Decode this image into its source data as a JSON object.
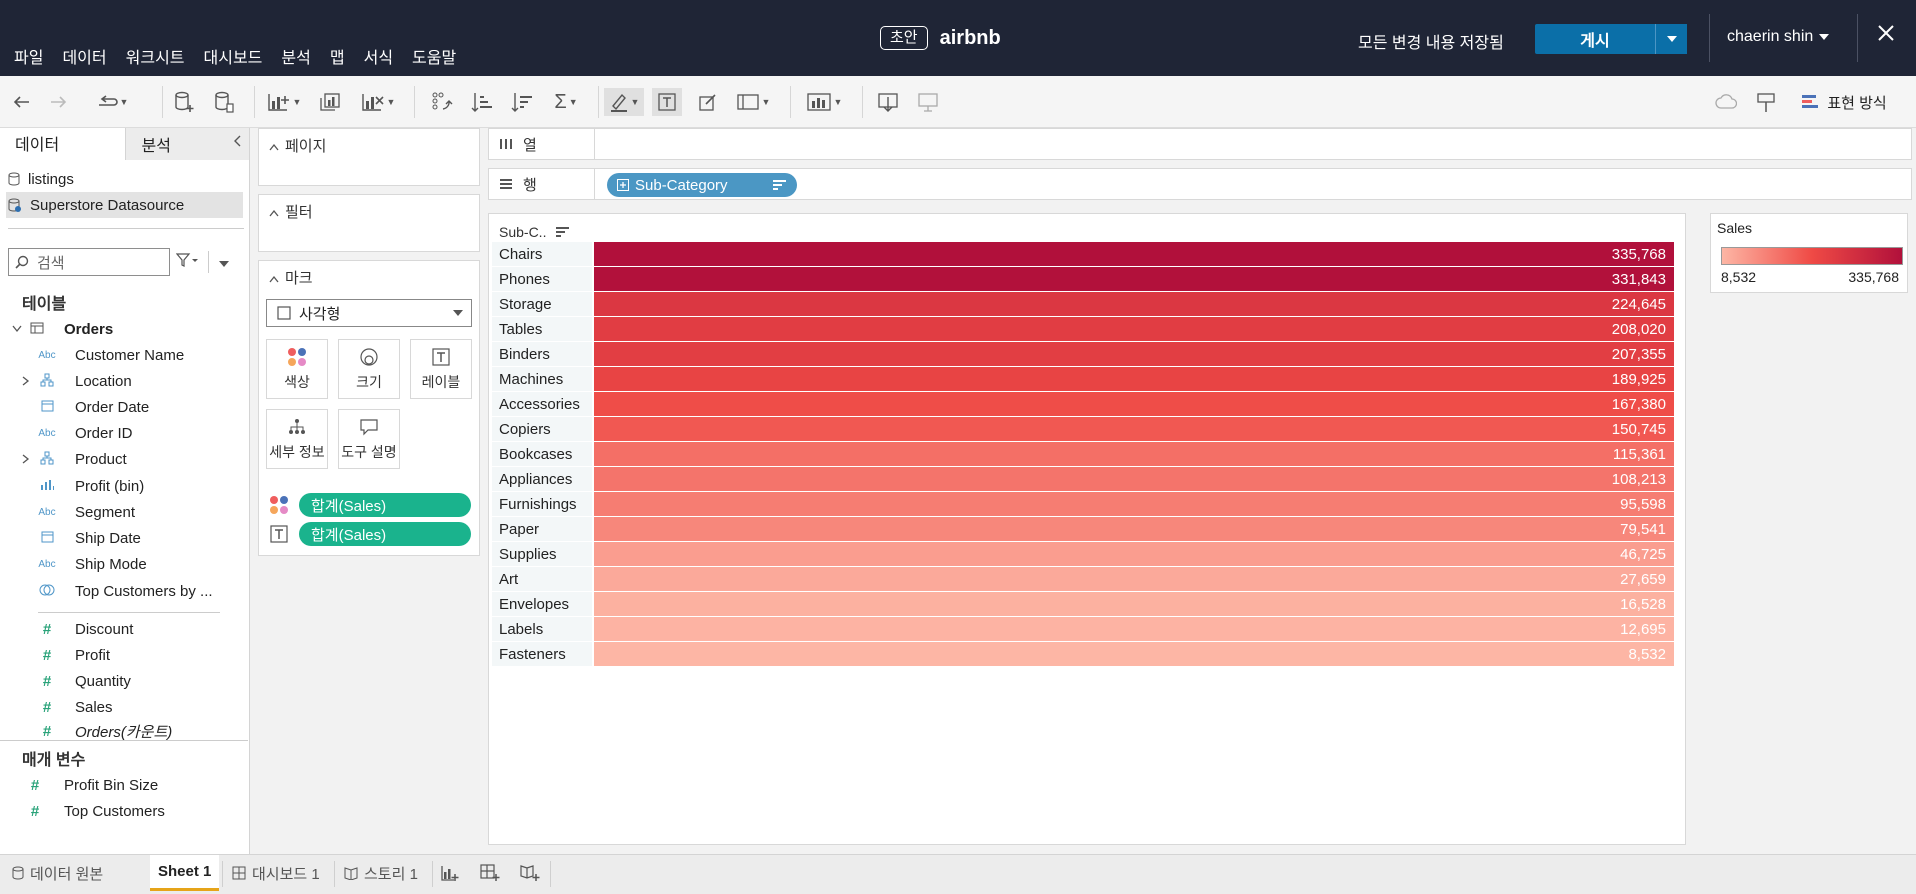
{
  "topbar": {
    "menu": [
      "파일",
      "데이터",
      "워크시트",
      "대시보드",
      "분석",
      "맵",
      "서식",
      "도움말"
    ],
    "draft_badge": "초안",
    "workbook_title": "airbnb",
    "save_status": "모든 변경 내용 저장됨",
    "publish_label": "게시",
    "user_name": "chaerin shin",
    "close_icon": "close-icon"
  },
  "toolbar": {
    "show_me_label": "표현 방식"
  },
  "data_pane": {
    "tabs": [
      "데이터",
      "분석"
    ],
    "datasources": [
      {
        "name": "listings",
        "icon": "cylinder-icon"
      },
      {
        "name": "Superstore Datasource",
        "icon": "cylinder-live-icon"
      }
    ],
    "search_placeholder": "검색",
    "tables_title": "테이블",
    "table_name": "Orders",
    "dimensions": [
      {
        "type": "Abc",
        "name": "Customer Name"
      },
      {
        "type": "hierarchy",
        "name": "Location",
        "expandable": true
      },
      {
        "type": "date",
        "name": "Order Date"
      },
      {
        "type": "Abc",
        "name": "Order ID"
      },
      {
        "type": "hierarchy",
        "name": "Product",
        "expandable": true
      },
      {
        "type": "bin",
        "name": "Profit (bin)"
      },
      {
        "type": "Abc",
        "name": "Segment"
      },
      {
        "type": "date",
        "name": "Ship Date"
      },
      {
        "type": "Abc",
        "name": "Ship Mode"
      },
      {
        "type": "set",
        "name": "Top Customers by ..."
      }
    ],
    "measures": [
      "Discount",
      "Profit",
      "Quantity",
      "Sales",
      "Orders(카운트)"
    ],
    "params_title": "매개 변수",
    "parameters": [
      "Profit Bin Size",
      "Top Customers"
    ]
  },
  "cards": {
    "pages_title": "페이지",
    "filters_title": "필터",
    "marks_title": "마크",
    "mark_type": "사각형",
    "mark_buttons": [
      "색상",
      "크기",
      "레이블",
      "세부 정보",
      "도구 설명"
    ],
    "mark_pills": [
      "합계(Sales)",
      "합계(Sales)"
    ]
  },
  "shelves": {
    "columns_label": "열",
    "rows_label": "행",
    "rows_pill": "Sub-Category"
  },
  "viz": {
    "header": "Sub-C..",
    "legend_title": "Sales",
    "legend_min": "8,532",
    "legend_max": "335,768",
    "colors": {
      "low": "#fdb6a5",
      "mid": "#ef4a45",
      "high": "#b1103b"
    }
  },
  "chart_data": {
    "type": "table",
    "categories": [
      "Chairs",
      "Phones",
      "Storage",
      "Tables",
      "Binders",
      "Machines",
      "Accessories",
      "Copiers",
      "Bookcases",
      "Appliances",
      "Furnishings",
      "Paper",
      "Supplies",
      "Art",
      "Envelopes",
      "Labels",
      "Fasteners"
    ],
    "values": [
      335768,
      331843,
      224645,
      208020,
      207355,
      189925,
      167380,
      150745,
      115361,
      108213,
      95598,
      79541,
      46725,
      27659,
      16528,
      12695,
      8532
    ],
    "labels": [
      "335,768",
      "331,843",
      "224,645",
      "208,020",
      "207,355",
      "189,925",
      "167,380",
      "150,745",
      "115,361",
      "108,213",
      "95,598",
      "79,541",
      "46,725",
      "27,659",
      "16,528",
      "12,695",
      "8,532"
    ],
    "color_field": "Sales"
  },
  "bottom_tabs": {
    "data_source": "데이터 원본",
    "sheet1": "Sheet 1",
    "dashboard1": "대시보드 1",
    "story1": "스토리 1"
  }
}
